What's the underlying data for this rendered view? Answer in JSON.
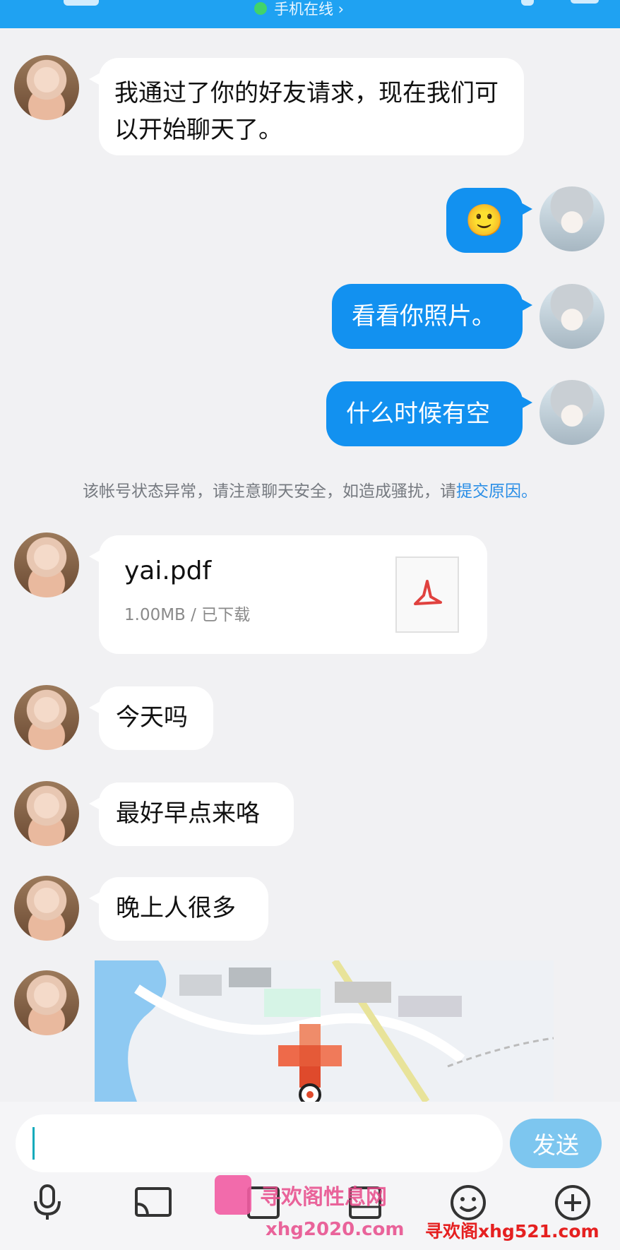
{
  "header": {
    "status_text": "手机在线 ›"
  },
  "messages": [
    {
      "text": "我通过了你的好友请求，现在我们可以开始聊天了。"
    },
    {
      "emoji": "🙂"
    },
    {
      "text": "看看你照片。"
    },
    {
      "text": "什么时候有空"
    },
    {
      "text": "今天吗"
    },
    {
      "text": "最好早点来咯"
    },
    {
      "text": "晚上人很多"
    }
  ],
  "system_notice": {
    "text": "该帐号状态异常，请注意聊天安全，如造成骚扰，请",
    "link": "提交原因。"
  },
  "file": {
    "name": "yai.pdf",
    "meta": "1.00MB / 已下载"
  },
  "composer": {
    "placeholder": "",
    "send_label": "发送"
  },
  "toolbar": {
    "icons": [
      "mic-icon",
      "screen-share-icon",
      "image-icon",
      "camera-icon",
      "emoji-icon",
      "plus-icon"
    ]
  },
  "watermark": {
    "text1": "寻欢阁性息网",
    "text2": "xhg2020.com",
    "text3": "寻欢阁xhg521.com"
  },
  "colors": {
    "topbar": "#1fa2f2",
    "outgoing_bubble": "#1291f0",
    "send_button": "#7dc6ef"
  }
}
